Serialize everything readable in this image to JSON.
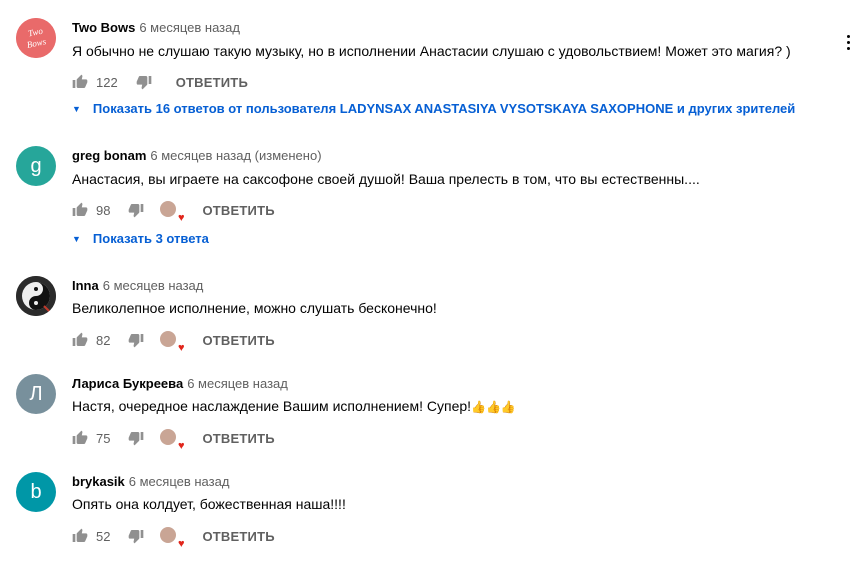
{
  "comments": [
    {
      "author": "Two Bows",
      "time": "6 месяцев назад",
      "text": "Я обычно не слушаю такую музыку, но  в исполнении Анастасии слушаю с удовольствием! Может это магия? )",
      "likes": "122",
      "reply_label": "ОТВЕТИТЬ",
      "replies_label": "Показать 16 ответов от пользователя LADYNSAX ANASTASIYA VYSOTSKAYA SAXOPHONE и других зрителей",
      "avatar_color": "#e96a6a",
      "avatar_text": "Two Bows"
    },
    {
      "author": "greg bonam",
      "time": "6 месяцев назад (изменено)",
      "text": "Анастасия, вы играете на саксофоне своей душой! Ваша прелесть в том, что вы естественны....",
      "likes": "98",
      "reply_label": "ОТВЕТИТЬ",
      "replies_label": "Показать 3 ответа",
      "avatar_color": "#26a69a",
      "avatar_letter": "g"
    },
    {
      "author": "Inna",
      "time": "6 месяцев назад",
      "text": "Великолепное исполнение, можно слушать бесконечно!",
      "likes": "82",
      "reply_label": "ОТВЕТИТЬ",
      "avatar_color": "#3a3a3a"
    },
    {
      "author": "Лариса Букреева",
      "time": "6 месяцев назад",
      "text": "Настя, очередное наслаждение Вашим исполнением! Супер!",
      "emoji": "👍👍👍",
      "likes": "75",
      "reply_label": "ОТВЕТИТЬ",
      "avatar_color": "#78909c",
      "avatar_letter": "Л"
    },
    {
      "author": "brykasik",
      "time": "6 месяцев назад",
      "text": "Опять она колдует, божественная наша!!!!",
      "likes": "52",
      "reply_label": "ОТВЕТИТЬ",
      "avatar_color": "#0097a7",
      "avatar_letter": "b"
    }
  ],
  "colors": {
    "link": "#065fd4",
    "meta": "#606060",
    "heart": "#e1251b"
  }
}
